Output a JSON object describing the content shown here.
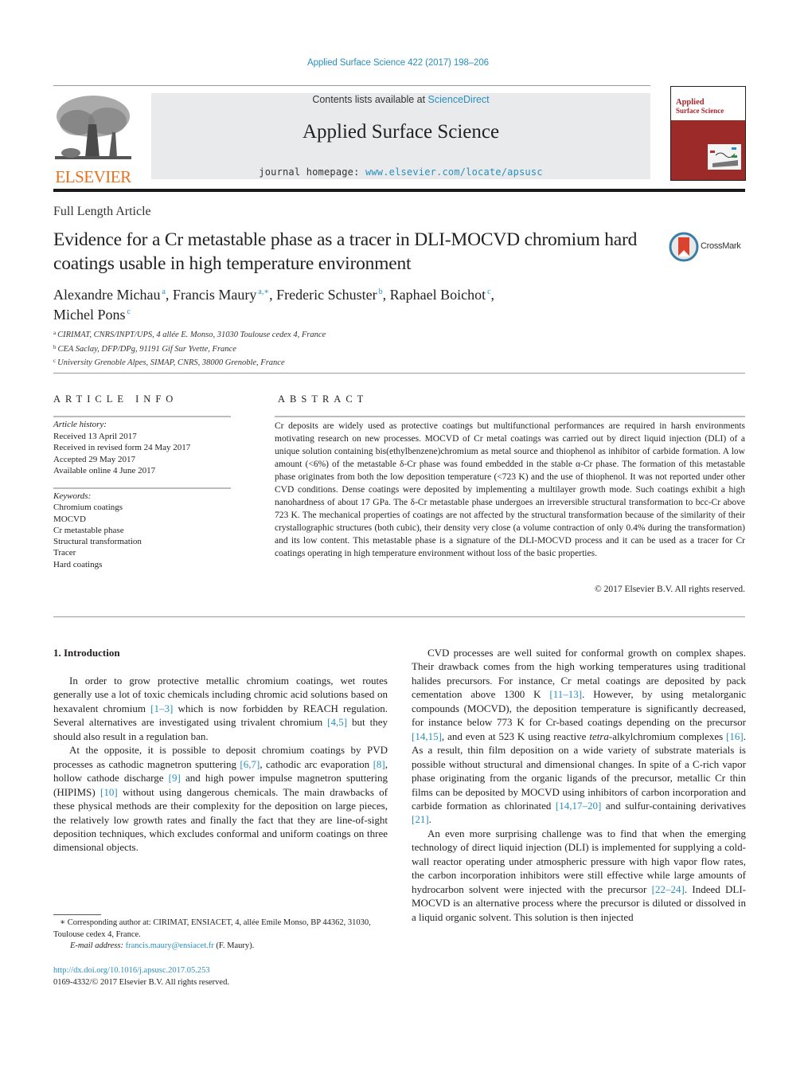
{
  "header": {
    "citation": "Applied Surface Science 422 (2017) 198–206",
    "contents_prefix": "Contents lists available at ",
    "contents_link": "ScienceDirect",
    "journal_title": "Applied Surface Science",
    "homepage_prefix": "journal homepage: ",
    "homepage_link": "www.elsevier.com/locate/apsusc",
    "publisher_logo_text": "ELSEVIER",
    "cover_title_line1": "Applied",
    "cover_title_line2": "Surface Science",
    "crossmark_label": "CrossMark"
  },
  "article": {
    "type": "Full Length Article",
    "title": "Evidence for a Cr metastable phase as a tracer in DLI-MOCVD chromium hard coatings usable in high temperature environment",
    "authors": [
      {
        "name": "Alexandre Michau",
        "sup": "a",
        "sep": ", "
      },
      {
        "name": "Francis Maury",
        "sup": "a,∗",
        "sep": ", "
      },
      {
        "name": "Frederic Schuster",
        "sup": "b",
        "sep": ", "
      },
      {
        "name": "Raphael Boichot",
        "sup": "c",
        "sep": ","
      },
      {
        "name": "Michel Pons",
        "sup": "c",
        "sep": ""
      }
    ],
    "affiliations": [
      {
        "key": "a",
        "text": "CIRIMAT, CNRS/INPT/UPS, 4 allée E. Monso, 31030 Toulouse cedex 4, France"
      },
      {
        "key": "b",
        "text": "CEA Saclay, DFP/DPg, 91191 Gif Sur Yvette, France"
      },
      {
        "key": "c",
        "text": "University Grenoble Alpes, SIMAP, CNRS, 38000 Grenoble, France"
      }
    ]
  },
  "article_info": {
    "heading": "ARTICLE INFO",
    "history_label": "Article history:",
    "history": [
      "Received 13 April 2017",
      "Received in revised form 24 May 2017",
      "Accepted 29 May 2017",
      "Available online 4 June 2017"
    ],
    "keywords_label": "Keywords:",
    "keywords": [
      "Chromium coatings",
      "MOCVD",
      "Cr metastable phase",
      "Structural transformation",
      "Tracer",
      "Hard coatings"
    ]
  },
  "abstract": {
    "heading": "ABSTRACT",
    "text": "Cr deposits are widely used as protective coatings but multifunctional performances are required in harsh environments motivating research on new processes. MOCVD of Cr metal coatings was carried out by direct liquid injection (DLI) of a unique solution containing bis(ethylbenzene)chromium as metal source and thiophenol as inhibitor of carbide formation. A low amount (<6%) of the metastable δ-Cr phase was found embedded in the stable α-Cr phase. The formation of this metastable phase originates from both the low deposition temperature (<723 K) and the use of thiophenol. It was not reported under other CVD conditions. Dense coatings were deposited by implementing a multilayer growth mode. Such coatings exhibit a high nanohardness of about 17 GPa. The δ-Cr metastable phase undergoes an irreversible structural transformation to bcc-Cr above 723 K. The mechanical properties of coatings are not affected by the structural transformation because of the similarity of their crystallographic structures (both cubic), their density very close (a volume contraction of only 0.4% during the transformation) and its low content. This metastable phase is a signature of the DLI-MOCVD process and it can be used as a tracer for Cr coatings operating in high temperature environment without loss of the basic properties.",
    "copyright": "© 2017 Elsevier B.V. All rights reserved."
  },
  "introduction": {
    "heading": "1.  Introduction",
    "left_paragraphs": [
      [
        {
          "t": "In order to grow protective metallic chromium coatings, wet routes generally use a lot of toxic chemicals including chromic acid solutions based on hexavalent chromium "
        },
        {
          "r": "[1–3]"
        },
        {
          "t": " which is now forbidden by REACH regulation. Several alternatives are investigated using trivalent chromium "
        },
        {
          "r": "[4,5]"
        },
        {
          "t": " but they should also result in a regulation ban."
        }
      ],
      [
        {
          "t": "At the opposite, it is possible to deposit chromium coatings by PVD processes as cathodic magnetron sputtering "
        },
        {
          "r": "[6,7]"
        },
        {
          "t": ", cathodic arc evaporation "
        },
        {
          "r": "[8]"
        },
        {
          "t": ", hollow cathode discharge "
        },
        {
          "r": "[9]"
        },
        {
          "t": " and high power impulse magnetron sputtering (HIPIMS) "
        },
        {
          "r": "[10]"
        },
        {
          "t": " without using dangerous chemicals. The main drawbacks of these physical methods are their complexity for the deposition on large pieces, the relatively low growth rates and finally the fact that they are line-of-sight deposition techniques, which excludes conformal and uniform coatings on three dimensional objects."
        }
      ]
    ],
    "right_paragraphs": [
      [
        {
          "t": "CVD processes are well suited for conformal growth on complex shapes. Their drawback comes from the high working temperatures using traditional halides precursors. For instance, Cr metal coatings are deposited by pack cementation above 1300 K "
        },
        {
          "r": "[11–13]"
        },
        {
          "t": ". However, by using metalorganic compounds (MOCVD), the deposition temperature is significantly decreased, for instance below 773 K for Cr-based coatings depending on the precursor "
        },
        {
          "r": "[14,15]"
        },
        {
          "t": ", and even at 523 K using reactive "
        },
        {
          "i": "tetra"
        },
        {
          "t": "-alkylchromium complexes "
        },
        {
          "r": "[16]"
        },
        {
          "t": ". As a result, thin film deposition on a wide variety of substrate materials is possible without structural and dimensional changes. In spite of a C-rich vapor phase originating from the organic ligands of the precursor, metallic Cr thin films can be deposited by MOCVD using inhibitors of carbon incorporation and carbide formation as chlorinated "
        },
        {
          "r": "[14,17–20]"
        },
        {
          "t": " and sulfur-containing derivatives "
        },
        {
          "r": "[21]"
        },
        {
          "t": "."
        }
      ],
      [
        {
          "t": "An even more surprising challenge was to find that when the emerging technology of direct liquid injection (DLI) is implemented for supplying a cold-wall reactor operating under atmospheric pressure with high vapor flow rates, the carbon incorporation inhibitors were still effective while large amounts of hydrocarbon solvent were injected with the precursor "
        },
        {
          "r": "[22–24]"
        },
        {
          "t": ". Indeed DLI-MOCVD is an alternative process where the precursor is diluted or dissolved in a liquid organic solvent. This solution is then injected"
        }
      ]
    ]
  },
  "footnote": {
    "corresponding": "∗  Corresponding author at: CIRIMAT, ENSIACET, 4, allée Emile Monso, BP 44362, 31030, Toulouse cedex 4, France.",
    "email_label": "E-mail address: ",
    "email": "francis.maury@ensiacet.fr",
    "email_suffix": " (F. Maury).",
    "doi": "http://dx.doi.org/10.1016/j.apsusc.2017.05.253",
    "issn_copyright": "0169-4332/© 2017 Elsevier B.V. All rights reserved."
  }
}
